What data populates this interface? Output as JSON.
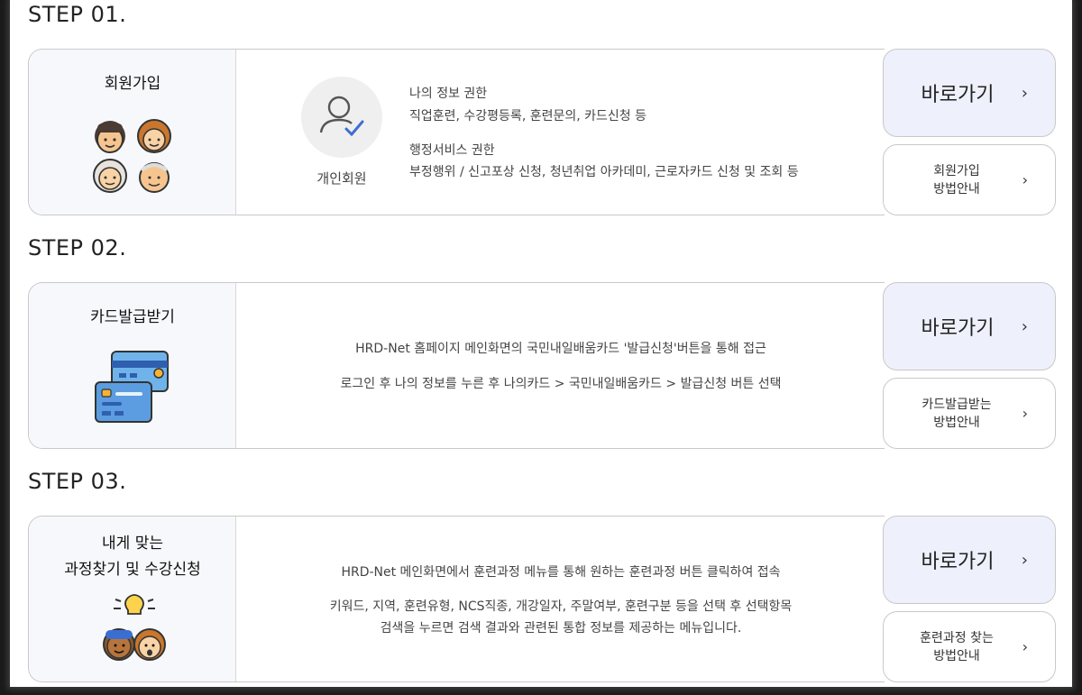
{
  "steps": [
    {
      "title": "STEP 01.",
      "left_title": "회원가입",
      "member_label": "개인회원",
      "info": {
        "h1": "나의 정보 권한",
        "l1": "직업훈련, 수강평등록, 훈련문의, 카드신청 등",
        "h2": "행정서비스 권한",
        "l2": "부정행위 / 신고포상 신청, 청년취업 아카데미, 근로자카드 신청 및 조회 등"
      },
      "main_button": "바로가기",
      "sub_button_line1": "회원가입",
      "sub_button_line2": "방법안내"
    },
    {
      "title": "STEP 02.",
      "left_title": "카드발급받기",
      "desc1": "HRD-Net 홈페이지 메인화면의 국민내일배움카드 '발급신청'버튼을 통해 접근",
      "desc2": "로그인 후 나의 정보를 누른 후 나의카드 > 국민내일배움카드 > 발급신청 버튼 선택",
      "main_button": "바로가기",
      "sub_button_line1": "카드발급받는",
      "sub_button_line2": "방법안내"
    },
    {
      "title": "STEP 03.",
      "left_title_line1": "내게 맞는",
      "left_title_line2": "과정찾기 및 수강신청",
      "desc1": "HRD-Net 메인화면에서 훈련과정 메뉴를 통해 원하는 훈련과정 버튼 클릭하여 접속",
      "desc2": "키워드, 지역, 훈련유형, NCS직종, 개강일자, 주말여부, 훈련구분 등을 선택 후 선택항목",
      "desc3": "검색을 누르면 검색 결과와 관련된 통합 정보를 제공하는 메뉴입니다.",
      "main_button": "바로가기",
      "sub_button_line1": "훈련과정 찾는",
      "sub_button_line2": "방법안내"
    }
  ],
  "icons": {
    "chevron": "›",
    "members_icon": "people-avatars-icon",
    "user_check_icon": "user-check-icon",
    "cards_icon": "credit-cards-icon",
    "idea_icon": "idea-people-icon"
  },
  "colors": {
    "accent_blue": "#3d6fd1",
    "button_bg": "#eef0fb",
    "panel_bg": "#f7f8fc"
  }
}
